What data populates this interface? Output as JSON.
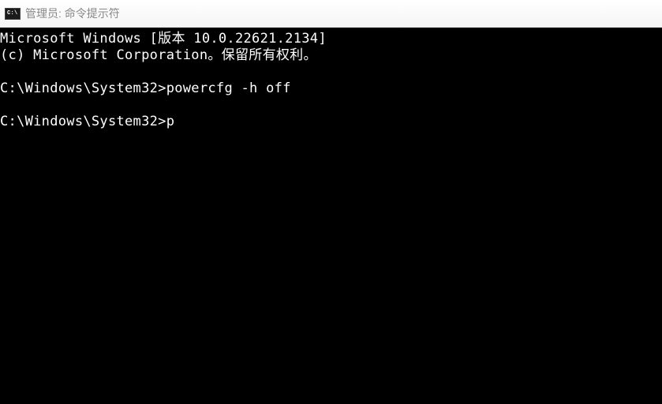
{
  "window": {
    "icon_label": "C:\\",
    "title": "管理员: 命令提示符"
  },
  "terminal": {
    "line1": "Microsoft Windows [版本 10.0.22621.2134]",
    "line2": "(c) Microsoft Corporation。保留所有权利。",
    "prompt1_path": "C:\\Windows\\System32>",
    "prompt1_cmd": "powercfg -h off",
    "prompt2_path": "C:\\Windows\\System32>",
    "prompt2_input": "p"
  }
}
